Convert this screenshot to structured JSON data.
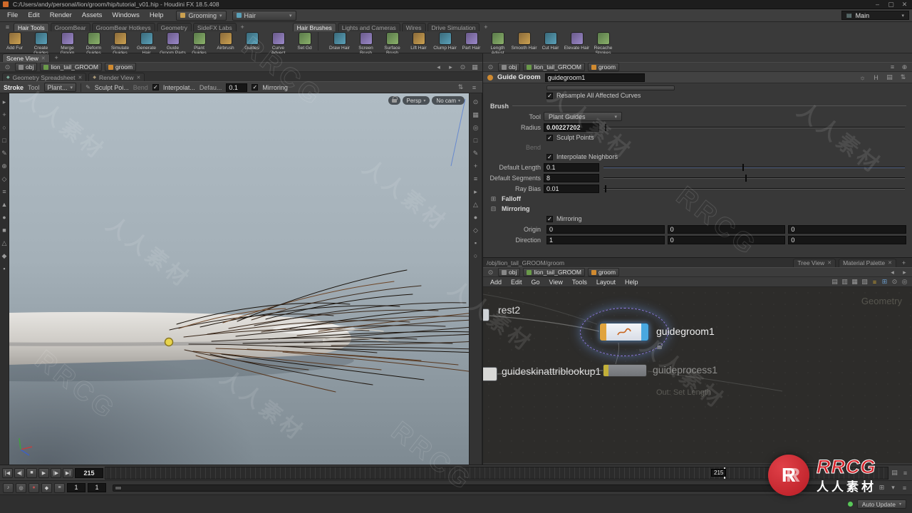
{
  "titlebar": {
    "title": "C:/Users/andy/personal/lion/groom/hip/tutorial_v01.hip - Houdini FX 18.5.408",
    "min": "–",
    "max": "▢",
    "close": "✕"
  },
  "menubar": {
    "items": [
      "File",
      "Edit",
      "Render",
      "Assets",
      "Windows",
      "Help"
    ],
    "grooming": "Grooming",
    "hair": "Hair",
    "desktop": "Main"
  },
  "shelf": {
    "tabs_left": [
      "Hair Tools",
      "GroomBear",
      "GroomBear Hotkeys",
      "Geometry",
      "SideFX Labs"
    ],
    "tabs_right": [
      "Hair Brushes",
      "Lights and Cameras",
      "Wires",
      "Drive Simulation"
    ],
    "tools_left": [
      "Add Fur",
      "Create Guides",
      "Merge Groom Layers",
      "Deform Guides",
      "Simulate Guides",
      "Generate Hair",
      "Guide Groom Parts",
      "Plant Guides",
      "Airbrush",
      "Guides",
      "Curve Advect",
      "Set Gd"
    ],
    "tools_right": [
      "Draw Hair",
      "Screen Brush",
      "Surface Brush",
      "Lift Hair",
      "Clump Hair",
      "Part Hair",
      "Length Adjust",
      "Smooth Hair",
      "Cut Hair",
      "Elevate Hair",
      "Recache Strokes"
    ]
  },
  "scene_pane": {
    "tab": "Scene View",
    "subtab1": "Geometry Spreadsheet",
    "subtab2": "Render View",
    "path": {
      "a": "obj",
      "b": "lion_tail_GROOM",
      "c": "groom"
    },
    "stroke": {
      "title": "Stroke",
      "tool": "Tool",
      "tool_value": "Plant...",
      "sculpt": "Sculpt Poi...",
      "bend": "Bend",
      "interp": "Interpolat...",
      "defau": "Defau...",
      "defau_value": "0.1",
      "mirroring": "Mirroring"
    },
    "viewport": {
      "persp": "Persp",
      "cam": "No cam"
    }
  },
  "params": {
    "path": {
      "a": "obj",
      "b": "lion_tail_GROOM",
      "c": "groom"
    },
    "header": {
      "type": "Guide Groom",
      "name": "guidegroom1"
    },
    "resample": "Resample All Affected Curves",
    "brush_section": "Brush",
    "tool_label": "Tool",
    "tool_value": "Plant Guides",
    "radius_label": "Radius",
    "radius_value": "0.00227202",
    "sculpt_points": "Sculpt Points",
    "bend": "Bend",
    "interpolate": "Interpolate Neighbors",
    "default_length_label": "Default Length",
    "default_length_value": "0.1",
    "default_segments_label": "Default Segments",
    "default_segments_value": "8",
    "ray_bias_label": "Ray Bias",
    "ray_bias_value": "0.01",
    "falloff_section": "Falloff",
    "mirroring_section": "Mirroring",
    "mirroring_check": "Mirroring",
    "origin_label": "Origin",
    "origin": {
      "x": "0",
      "y": "0",
      "z": "0"
    },
    "direction_label": "Direction",
    "direction": {
      "x": "1",
      "y": "0",
      "z": "0"
    }
  },
  "network": {
    "pane_path": "/obj/lion_tail_GROOM/groom",
    "tab1": "Tree View",
    "tab2": "Material Palette",
    "path": {
      "a": "obj",
      "b": "lion_tail_GROOM",
      "c": "groom"
    },
    "menu": [
      "Add",
      "Edit",
      "Go",
      "View",
      "Tools",
      "Layout",
      "Help"
    ],
    "context": "Geometry",
    "nodes": {
      "rest": "rest2",
      "guidegroom": "guidegroom1",
      "lookup": "guideskinattriblookup1",
      "process": "guideprocess1",
      "out": "Out: Set Length"
    }
  },
  "playbar": {
    "frame": "215",
    "playhead": "215",
    "field1": "1",
    "field2": "1",
    "auto_update": "Auto Update"
  },
  "watermark": {
    "cn": "人人素材",
    "en": "RRCG"
  },
  "logo": {
    "brand": "RRCG",
    "name": "人人素材"
  },
  "glyphs": {
    "plus": "+",
    "close": "✕",
    "check": "✓",
    "arrow_down": "▾",
    "back": "◂",
    "forward": "▸",
    "pin": "⊙",
    "pencil": "✎",
    "to_start": "|◀",
    "prev": "◀|",
    "stop": "■",
    "play": "▶",
    "next": "|▶",
    "to_end": "▶|",
    "expand": "⊞",
    "collapse": "⊟",
    "diamond": "◆",
    "sort": "⇅",
    "menu_lines": "≡"
  },
  "icon_strips": {
    "left_toolbar": [
      "▸",
      "+",
      "○",
      "□",
      "✎",
      "⊕",
      "◇",
      "≡",
      "▲",
      "●",
      "■",
      "△",
      "◆",
      "▪"
    ],
    "viewport_bar": [
      "⊙",
      "▦",
      "◎",
      "□",
      "✎",
      "+",
      "≡",
      "▸",
      "△",
      "●",
      "◇",
      "▪",
      "○"
    ],
    "network_icons": [
      "▤",
      "▥",
      "▦",
      "▧",
      "≡",
      "⊞",
      "⊙",
      "◎"
    ],
    "params_header_icons": [
      "☼",
      "H",
      "▤",
      "⇅"
    ],
    "scene_path_icons": [
      "◂",
      "▸",
      "⊙",
      "▦"
    ],
    "param_path_icons": [
      "≡",
      "⊕"
    ],
    "audio_icons": [
      "♪",
      "◎",
      "●",
      "◆",
      "≡"
    ],
    "playbar_right_icons": [
      "▤",
      "≡"
    ],
    "row2_right_icons": [
      "⊞",
      "▾",
      "≡"
    ]
  }
}
